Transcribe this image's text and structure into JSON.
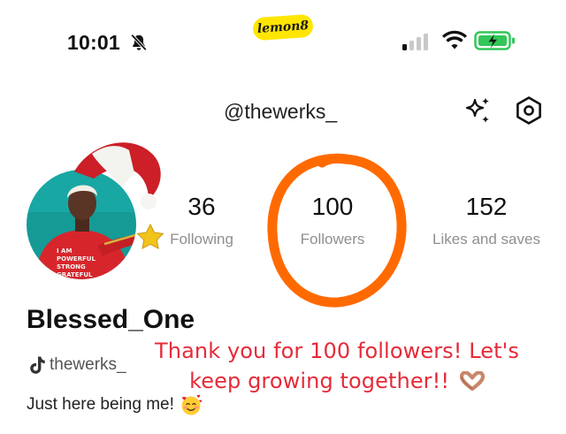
{
  "status_bar": {
    "time": "10:01",
    "app_logo_text": "lemon8",
    "icons": [
      "bell-slash-icon",
      "signal-icon",
      "wifi-icon",
      "battery-charging-icon"
    ],
    "battery_color": "#32c759"
  },
  "header": {
    "handle": "@thewerks_",
    "actions": [
      "sparkle-icon",
      "settings-hexagon-icon"
    ]
  },
  "stats": [
    {
      "value": "36",
      "label": "Following"
    },
    {
      "value": "100",
      "label": "Followers"
    },
    {
      "value": "152",
      "label": "Likes and saves"
    }
  ],
  "profile": {
    "display_name": "Blessed_One",
    "tiktok_handle": "thewerks_",
    "bio": "Just here being me!",
    "bio_emoji": "smiling-face-with-hearts"
  },
  "overlay": {
    "line1": "Thank you for 100 followers! Let's",
    "line2": "keep growing together!!",
    "emoji": "heart-hands",
    "text_color": "#e52b39",
    "annotation_color": "#ff6a00"
  }
}
